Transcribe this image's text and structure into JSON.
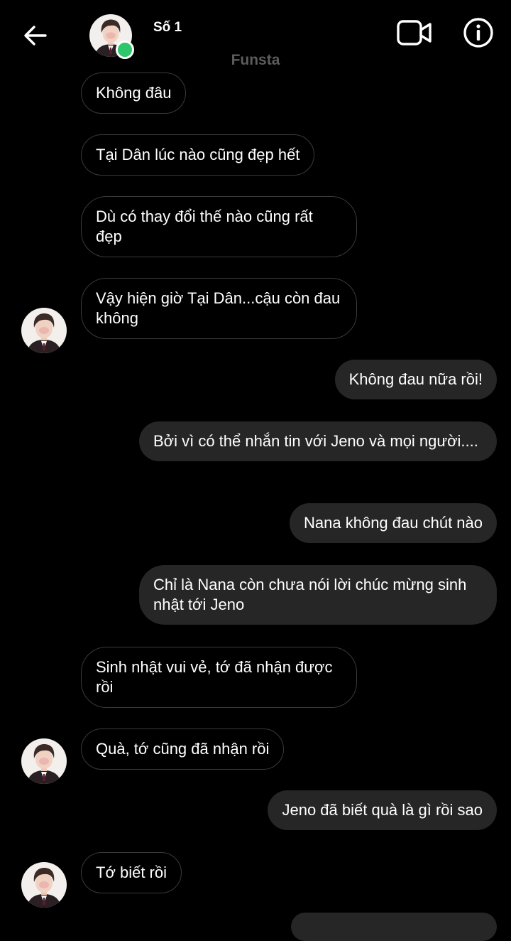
{
  "header": {
    "contact_name": "Số 1",
    "subtitle": "Funsta",
    "online": true
  },
  "icons": {
    "back": "back-arrow-icon",
    "video": "video-call-icon",
    "info": "info-icon"
  },
  "colors": {
    "background": "#000000",
    "outgoing_bubble": "#262626",
    "incoming_border": "#3a3a3a",
    "online": "#2ec66b",
    "subtitle": "#5c5c5c"
  },
  "messages": [
    {
      "direction": "in",
      "text": "Không đâu"
    },
    {
      "direction": "in",
      "text": "Tại Dân lúc nào cũng đẹp hết"
    },
    {
      "direction": "in",
      "text": "Dù có thay đổi thế nào cũng rất đẹp"
    },
    {
      "direction": "in",
      "text": "Vậy hiện giờ Tại Dân...cậu còn đau không",
      "avatar": true
    },
    {
      "direction": "out",
      "text": "Không đau nữa rồi!"
    },
    {
      "direction": "out",
      "text": "Bởi vì có thể nhắn tin với Jeno và mọi người...."
    },
    {
      "direction": "out",
      "text": "Nana không đau chút nào"
    },
    {
      "direction": "out",
      "text": "Chỉ là Nana còn chưa nói lời chúc mừng sinh nhật tới Jeno"
    },
    {
      "direction": "in",
      "text": "Sinh nhật vui vẻ, tớ đã nhận được rồi"
    },
    {
      "direction": "in",
      "text": "Quà, tớ cũng đã nhận rồi",
      "avatar": true
    },
    {
      "direction": "out",
      "text": "Jeno đã biết quà là gì rồi sao"
    },
    {
      "direction": "in",
      "text": "Tớ biết rồi",
      "avatar": true
    }
  ]
}
